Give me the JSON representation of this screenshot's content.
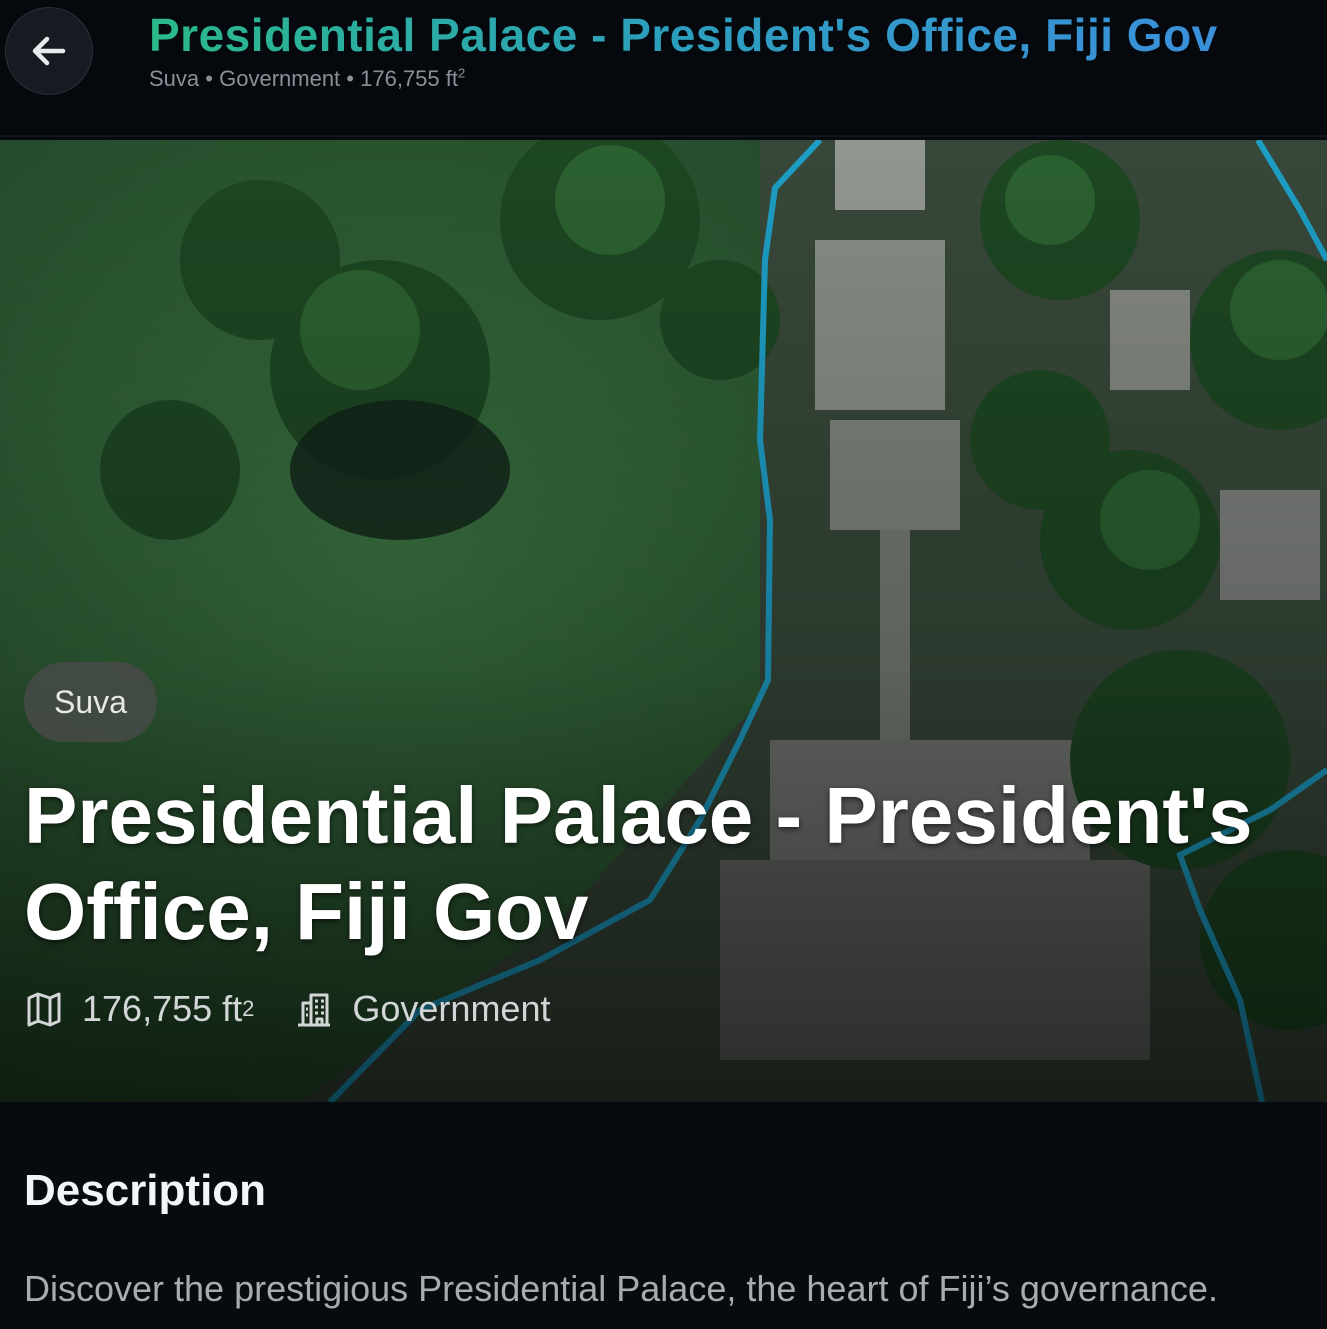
{
  "header": {
    "back_icon": "arrow-left-icon",
    "title": "Presidential Palace - President's Office, Fiji Gov",
    "subtitle_city": "Suva",
    "subtitle_category": "Government",
    "subtitle_area": "176,755 ft",
    "subtitle_area_unit_sup": "2",
    "separator": "•"
  },
  "hero": {
    "image": "aerial-satellite-view",
    "outline_color": "#1fa6cf",
    "chip_label": "Suva",
    "title": "Presidential Palace - President's Office, Fiji Gov",
    "area_icon": "map-icon",
    "area_value": "176,755 ft",
    "area_unit_sup": "2",
    "category_icon": "building-icon",
    "category": "Government"
  },
  "description": {
    "heading": "Description",
    "text": "Discover the prestigious Presidential Palace, the heart of Fiji’s governance."
  }
}
